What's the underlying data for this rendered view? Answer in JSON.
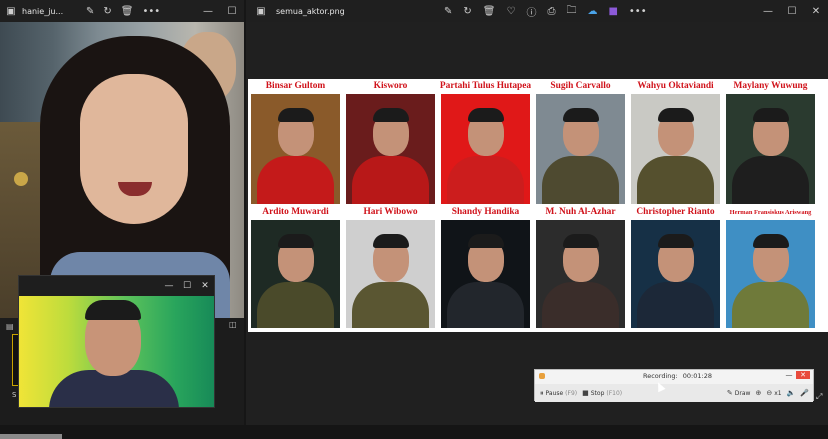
{
  "left_window": {
    "title": "hanie_ju...",
    "toolbar_icons": [
      "edit-icon",
      "rotate-icon",
      "delete-icon",
      "more-icon"
    ],
    "more": "•••",
    "controls": {
      "minimize": "—",
      "maximize": "☐"
    }
  },
  "webcam_window": {
    "controls": {
      "minimize": "—",
      "maximize": "☐",
      "close": "✕"
    }
  },
  "right_window": {
    "title": "semua_aktor.png",
    "toolbar_icons": [
      "edit-icon",
      "rotate-icon",
      "delete-icon",
      "heart-icon",
      "info-icon",
      "print-icon",
      "folder-icon",
      "cloud-icon",
      "app-icon",
      "more-icon"
    ],
    "more": "•••",
    "controls": {
      "minimize": "—",
      "maximize": "☐",
      "close": "✕"
    }
  },
  "collage": {
    "row1": [
      {
        "name": "Binsar Gultom",
        "bg": "#8a5a2a",
        "robe": "#c41a1a"
      },
      {
        "name": "Kisworo",
        "bg": "#6a1c1c",
        "robe": "#b81818"
      },
      {
        "name": "Partahi Tulus Hutapea",
        "bg": "#e01818",
        "robe": "#cc1d1d"
      },
      {
        "name": "Sugih Carvallo",
        "bg": "#7f8a92",
        "robe": "#4e4a30"
      },
      {
        "name": "Wahyu Oktaviandi",
        "bg": "#c9c9c4",
        "robe": "#55502e"
      },
      {
        "name": "Maylany Wuwung",
        "bg": "#2a3a2f",
        "robe": "#1e1e1e"
      }
    ],
    "row2": [
      {
        "name": "Ardito Muwardi",
        "bg": "#1e2a24",
        "robe": "#4a4a2a"
      },
      {
        "name": "Hari Wibowo",
        "bg": "#cfcfcf",
        "robe": "#5a5632"
      },
      {
        "name": "Shandy Handika",
        "bg": "#101418",
        "robe": "#22262c"
      },
      {
        "name": "M. Nuh Al-Azhar",
        "bg": "#2c2c2c",
        "robe": "#3a2d2a"
      },
      {
        "name": "Christopher Rianto",
        "bg": "#163046",
        "robe": "#1c2838"
      },
      {
        "name": "Herman Fransiskus Ariswang",
        "bg": "#3f8fc4",
        "robe": "#6f7a3a"
      }
    ]
  },
  "recorder": {
    "status_label": "Recording:",
    "elapsed": "00:01:28",
    "pause_label": "Pause",
    "pause_key": "(F9)",
    "stop_label": "Stop",
    "stop_key": "(F10)",
    "draw_label": "Draw",
    "zoom_label": "x1",
    "controls": {
      "minimize": "—",
      "close": "✕"
    }
  }
}
